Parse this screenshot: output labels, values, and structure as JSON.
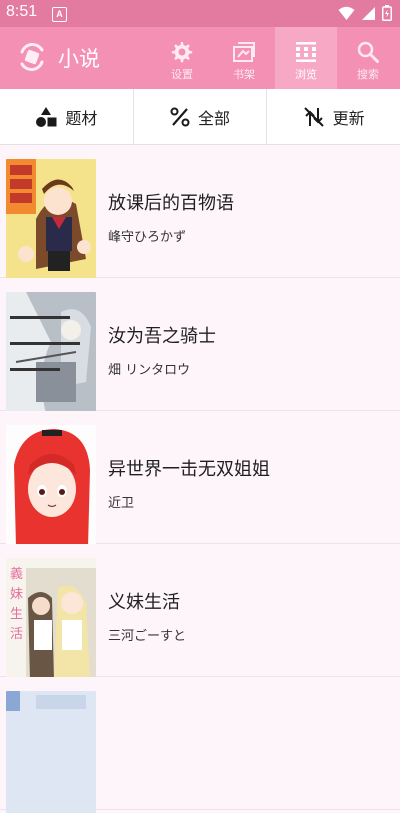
{
  "status_bar": {
    "time": "8:51",
    "notification_glyph": "A",
    "icons": [
      "wifi-icon",
      "signal-icon",
      "battery-icon"
    ]
  },
  "app_bar": {
    "title": "小说",
    "tabs": [
      {
        "label": "设置",
        "icon": "gear-icon",
        "active": false
      },
      {
        "label": "书架",
        "icon": "bookshelf-icon",
        "active": false
      },
      {
        "label": "浏览",
        "icon": "browse-icon",
        "active": true
      },
      {
        "label": "搜索",
        "icon": "search-icon",
        "active": false
      }
    ]
  },
  "filters": [
    {
      "label": "题材",
      "icon": "shapes-icon"
    },
    {
      "label": "全部",
      "icon": "percent-icon"
    },
    {
      "label": "更新",
      "icon": "sort-off-icon"
    }
  ],
  "books": [
    {
      "title": "放课后的百物语",
      "author": "峰守ひろかず"
    },
    {
      "title": "汝为吾之骑士",
      "author": "畑 リンタロウ"
    },
    {
      "title": "异世界一击无双姐姐",
      "author": "近卫"
    },
    {
      "title": "义妹生活",
      "author": "三河ごーすと"
    },
    {
      "title": "",
      "author": ""
    }
  ],
  "colors": {
    "status_bar": "#e37aa0",
    "app_bar": "#f390b4",
    "active_tab": "#f6a8c5",
    "background": "#fdf5f9"
  }
}
